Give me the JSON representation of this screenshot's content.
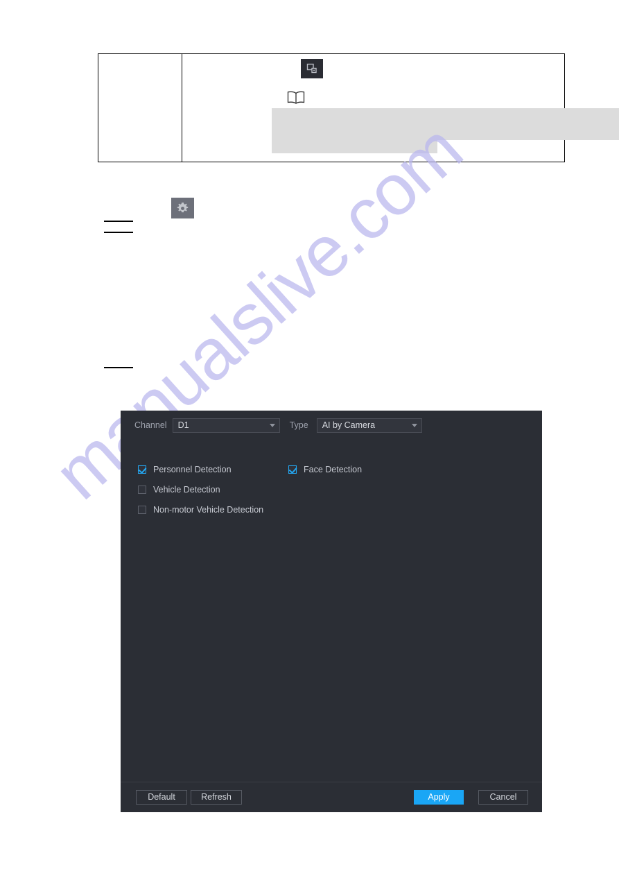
{
  "page": {
    "watermark": "manualslive.com",
    "watermark_color": "#b9b6ee",
    "background": "#ffffff"
  },
  "note_table": {
    "left_cell": "",
    "chip_icon": "copy-channel-icon",
    "note_icon": "open-book-icon",
    "redacted_block_count": 2
  },
  "steps": {
    "gear_icon": "gear-icon",
    "rule_count": 3
  },
  "dialog": {
    "background": "#2b2e35",
    "channel": {
      "label": "Channel",
      "value": "D1"
    },
    "type": {
      "label": "Type",
      "value": "AI by Camera"
    },
    "detections": [
      {
        "label": "Personnel Detection",
        "checked": true
      },
      {
        "label": "Face Detection",
        "checked": true
      },
      {
        "label": "Vehicle Detection",
        "checked": false
      },
      {
        "label": "Non-motor Vehicle Detection",
        "checked": false
      }
    ],
    "buttons": {
      "default": "Default",
      "refresh": "Refresh",
      "apply": "Apply",
      "cancel": "Cancel"
    },
    "accent_color": "#1aa6f5",
    "checkbox_color": "#23a7f2"
  }
}
